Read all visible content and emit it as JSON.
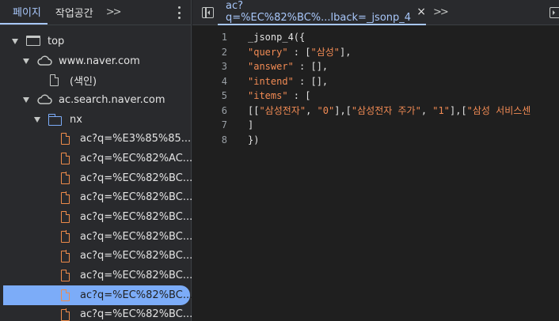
{
  "navigator": {
    "tabs": [
      {
        "label": "페이지"
      },
      {
        "label": "작업공간"
      }
    ],
    "more_label": ">>",
    "tree": {
      "top": "top",
      "domain1": "www.naver.com",
      "index_file": "(색인)",
      "domain2": "ac.search.naver.com",
      "folder": "nx",
      "files": [
        "ac?q=%E3%85%85...",
        "ac?q=%EC%82%AC...",
        "ac?q=%EC%82%BC...",
        "ac?q=%EC%82%BC...",
        "ac?q=%EC%82%BC...",
        "ac?q=%EC%82%BC...",
        "ac?q=%EC%82%BC...",
        "ac?q=%EC%82%BC...",
        "ac?q=%EC%82%BC...",
        "ac?q=%EC%82%BC..."
      ],
      "selected_index": 8
    }
  },
  "editor": {
    "tab_label": "ac?q=%EC%82%BC%...lback=_jsonp_4",
    "close_label": "×",
    "more_label": ">>",
    "line_numbers": [
      "1",
      "2",
      "3",
      "4",
      "5",
      "6",
      "7",
      "8"
    ],
    "lines": {
      "l1": "_jsonp_4({",
      "l2_key": "\"query\"",
      "l2_rest_a": " : [",
      "l2_val": "\"삼성\"",
      "l2_rest_b": "],",
      "l3_key": "\"answer\"",
      "l3_rest": " : [],",
      "l4_key": "\"intend\"",
      "l4_rest": " : [],",
      "l5_key": "\"items\"",
      "l5_rest": " : [",
      "l6_a": "[[",
      "l6_s1": "\"삼성전자\"",
      "l6_b": ", ",
      "l6_s2": "\"0\"",
      "l6_c": "],[",
      "l6_s3": "\"삼성전자 주가\"",
      "l6_d": ", ",
      "l6_s4": "\"1\"",
      "l6_e": "],[",
      "l6_s5": "\"삼성 서비스센",
      "l7": "]",
      "l8": "})"
    }
  },
  "colors": {
    "accent": "#a8c7fa",
    "selected_row": "#7cacf8",
    "string": "#f28b54",
    "file_icon": "#ee8b4a"
  },
  "icons": [
    "window-icon",
    "cloud-icon",
    "document-icon",
    "folder-icon",
    "kebab-menu-icon",
    "toggle-navigator-icon",
    "toggle-debugger-icon"
  ]
}
